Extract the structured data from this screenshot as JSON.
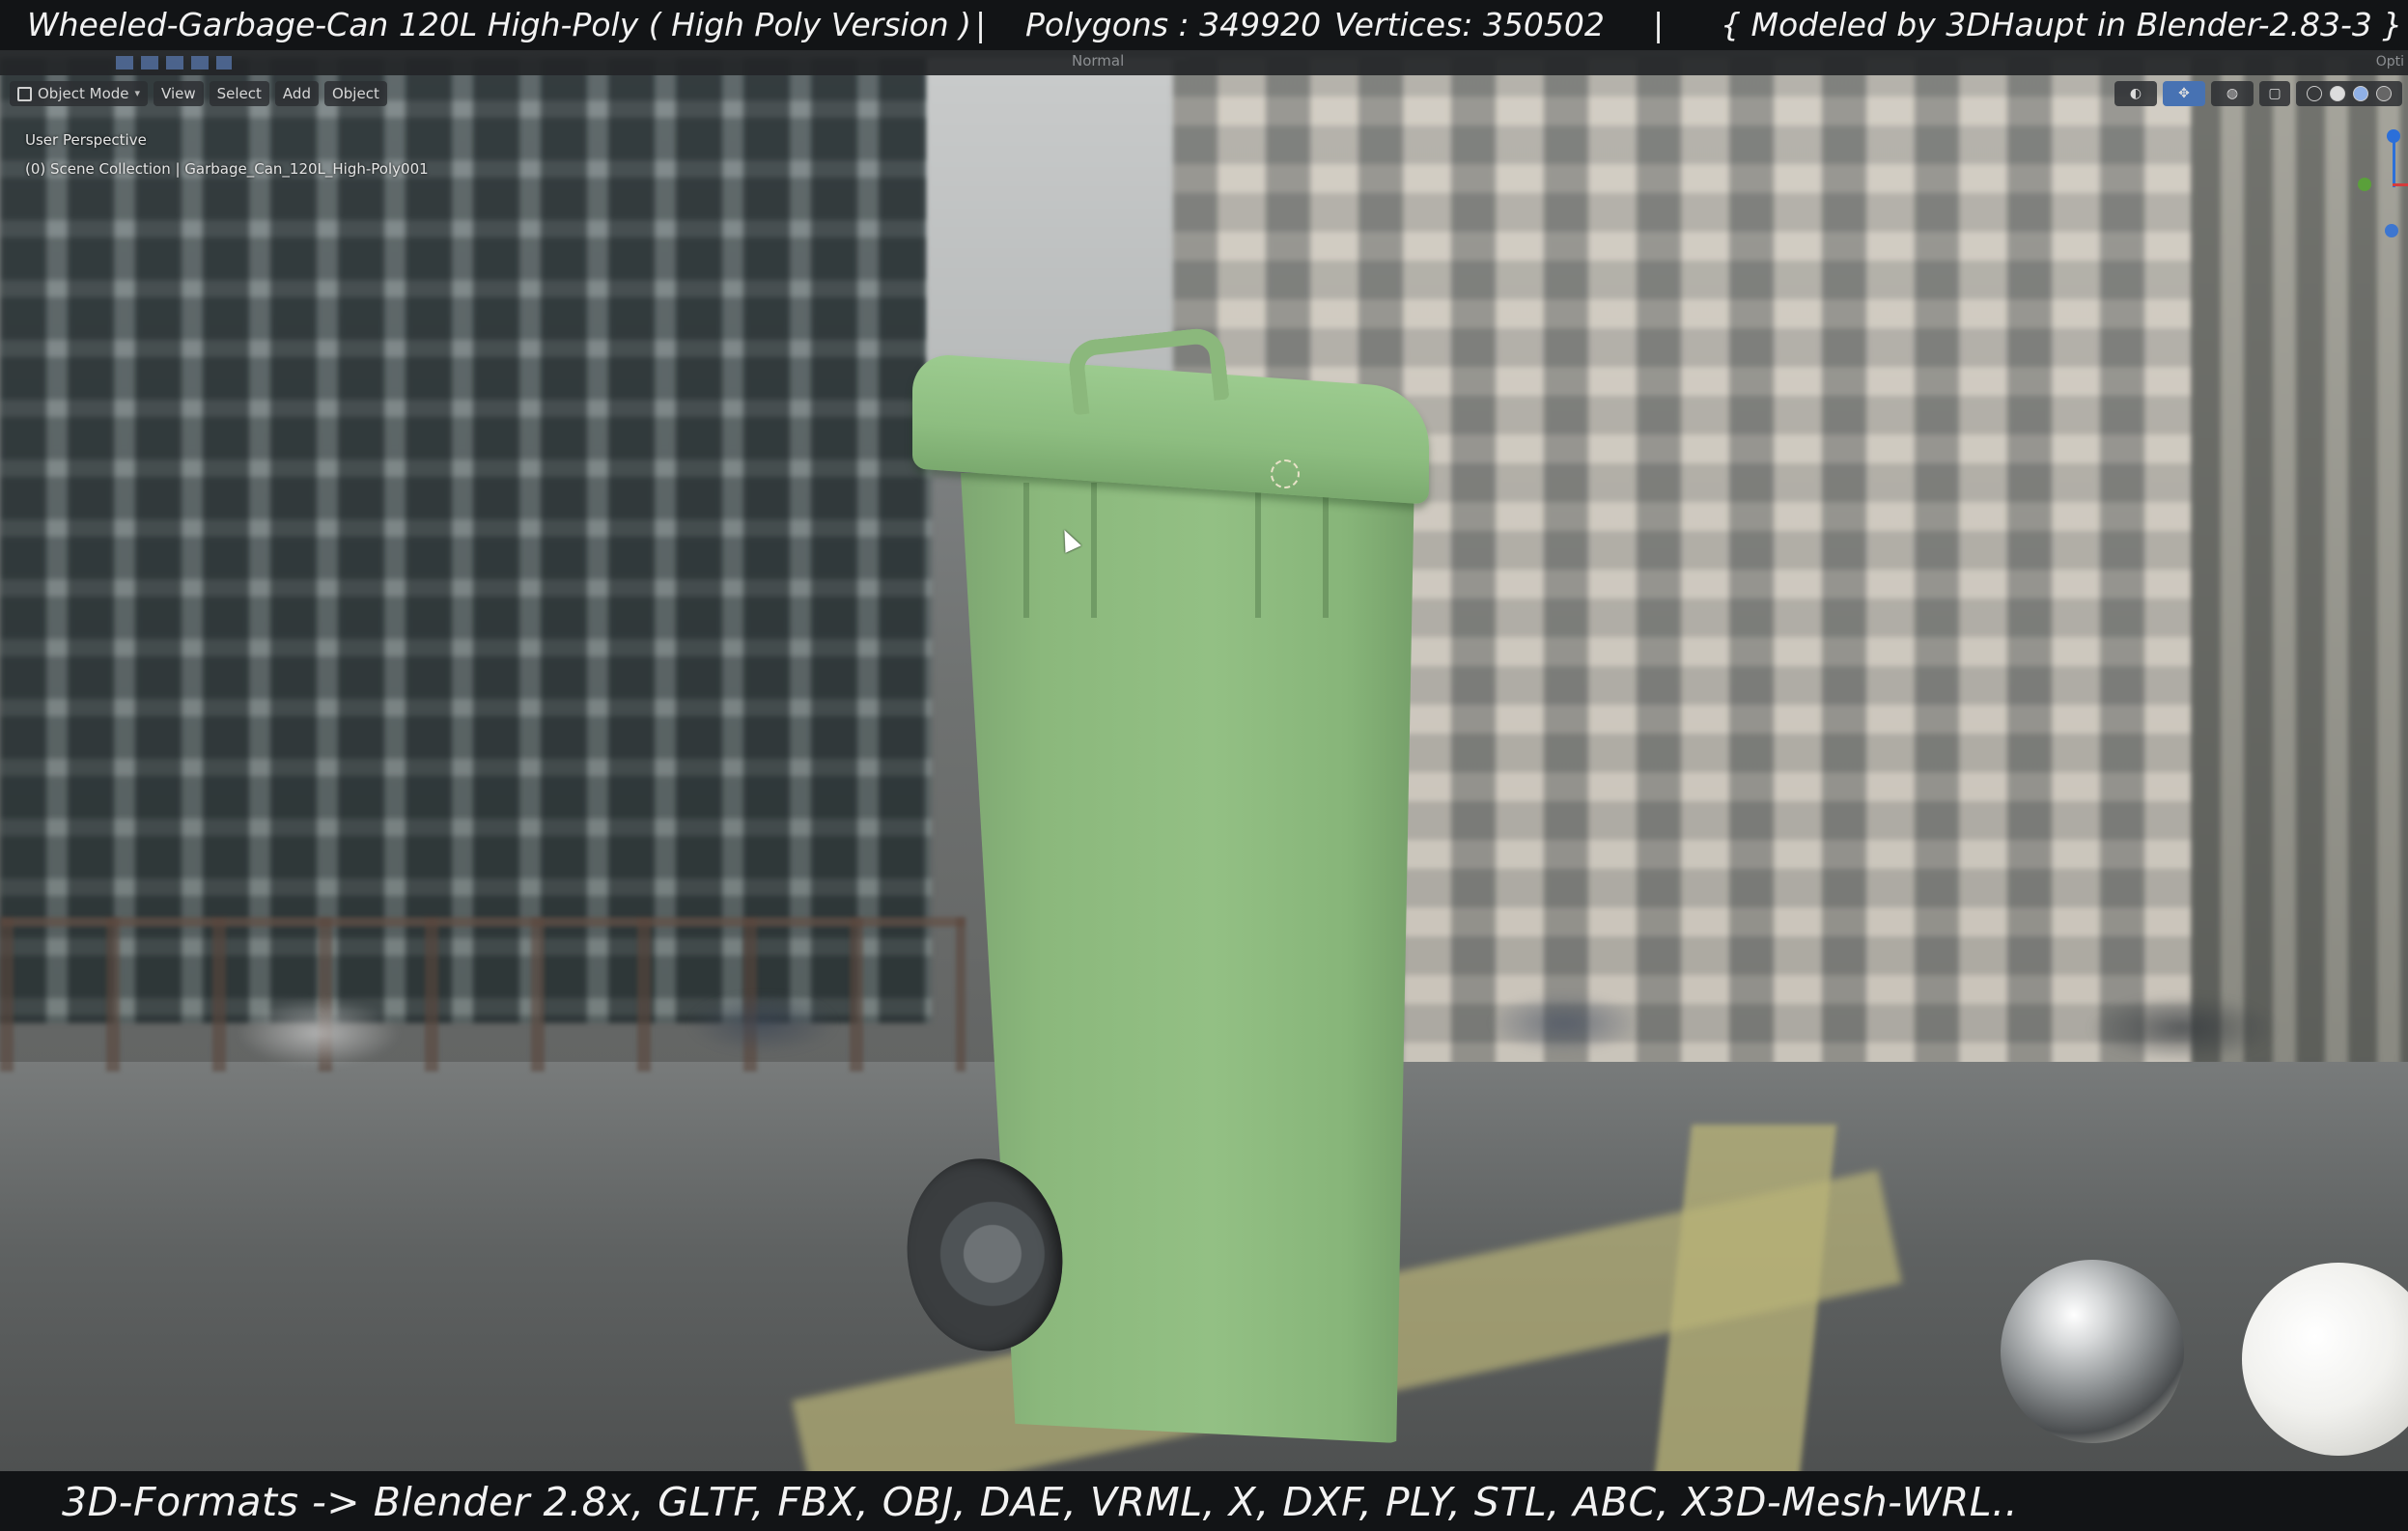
{
  "info_bar": {
    "title": "Wheeled-Garbage-Can 120L High-Poly ( High Poly Version )",
    "separator": "|",
    "polygons": "Polygons : 349920",
    "vertices": "Vertices: 350502",
    "modeled_by": "{ Modeled by 3DHaupt in Blender-2.83-3 }"
  },
  "blender_header": {
    "shading_label": "Normal",
    "options_label": "Opti"
  },
  "viewport_header": {
    "mode": "Object Mode",
    "menus": [
      "View",
      "Select",
      "Add",
      "Object"
    ]
  },
  "viewport_info": {
    "perspective": "User Perspective",
    "collection": "(0) Scene Collection | Garbage_Can_120L_High-Poly001"
  },
  "formats_bar": {
    "text": "3D-Formats -> Blender 2.8x, GLTF, FBX, OBJ, DAE, VRML, X, DXF, PLY, STL, ABC, X3D-Mesh-WRL.."
  },
  "colors": {
    "can_green": "#8bb87c",
    "overlay_bg": "#121416",
    "active_button": "#4772b3"
  },
  "icons": [
    "object-mode-icon",
    "visibility-icon",
    "gizmo-toggle-icon",
    "overlay-icon",
    "xray-icon",
    "wireframe-shading-icon",
    "solid-shading-icon",
    "material-shading-icon",
    "rendered-shading-icon",
    "navigation-gizmo-icon"
  ]
}
